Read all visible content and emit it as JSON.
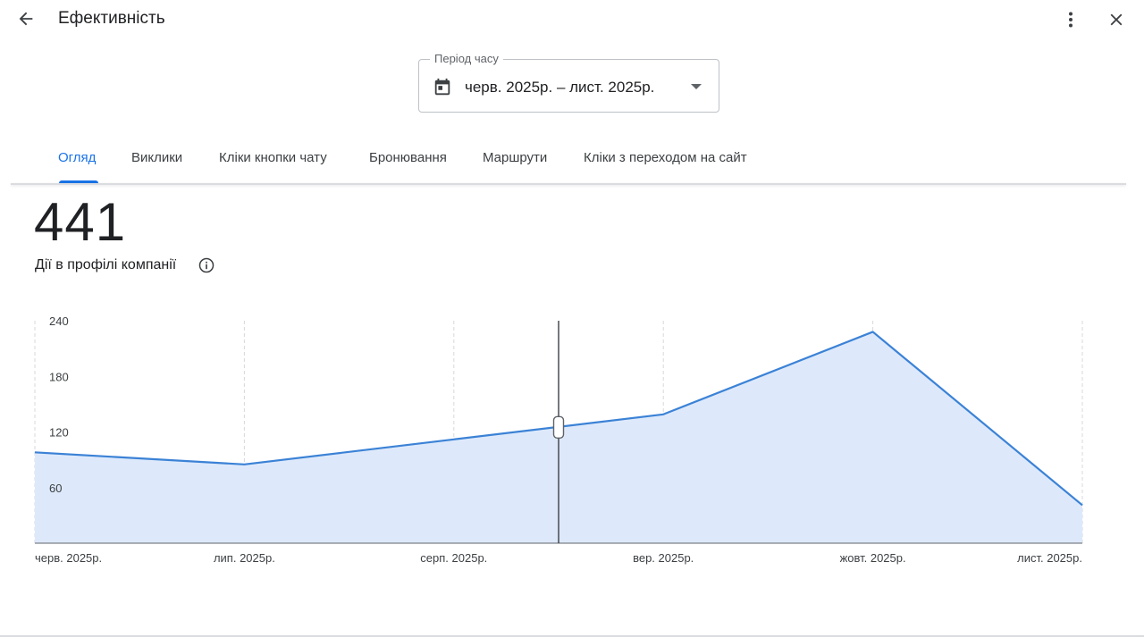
{
  "header": {
    "title": "Ефективність",
    "back_icon": "arrow-back-icon",
    "more_icon": "more-vert-icon",
    "close_icon": "close-icon"
  },
  "period": {
    "label": "Період часу",
    "value": "черв. 2025р. – лист. 2025р.",
    "icon": "calendar-icon"
  },
  "tabs": [
    {
      "label": "Огляд",
      "active": true
    },
    {
      "label": "Виклики",
      "active": false
    },
    {
      "label": "Кліки кнопки чату",
      "active": false
    },
    {
      "label": "Бронювання",
      "active": false
    },
    {
      "label": "Маршрути",
      "active": false
    },
    {
      "label": "Кліки з переходом на сайт",
      "active": false
    }
  ],
  "metric": {
    "value": "441",
    "label": "Дії в профілі компанії",
    "info_icon": "info-icon"
  },
  "colors": {
    "accent": "#1a73e8",
    "line": "#3b82d6",
    "area": "#dde9fb"
  },
  "chart_data": {
    "type": "area",
    "x": [
      "черв. 2025р.",
      "лип. 2025р.",
      "серп. 2025р.",
      "вер. 2025р.",
      "жовт. 2025р.",
      "лист. 2025р."
    ],
    "y_ticks": [
      60,
      120,
      180,
      240
    ],
    "ylim": [
      0,
      240
    ],
    "series": [
      {
        "values": [
          98,
          85,
          112,
          139,
          228,
          41
        ]
      }
    ],
    "cursor_value": 125,
    "grid": "vertical dashed"
  }
}
